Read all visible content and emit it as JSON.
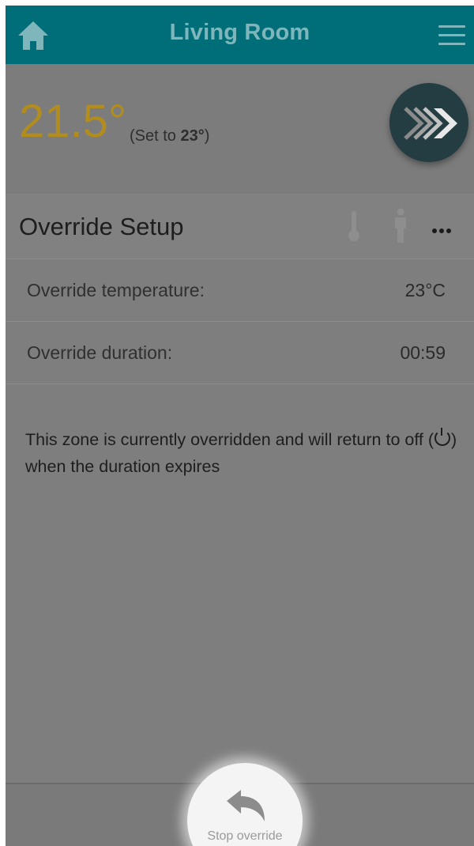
{
  "header": {
    "title": "Living Room",
    "home_icon": "home-icon",
    "menu_icon": "hamburger-menu-icon"
  },
  "temperature": {
    "current": "21.5°",
    "set_prefix": "(Set to ",
    "set_value": "23°",
    "set_suffix": ")",
    "boost_icon": "fast-forward-chevrons-icon"
  },
  "override_setup": {
    "title": "Override Setup",
    "icons": [
      "thermometer-icon",
      "person-icon",
      "more-icon"
    ],
    "rows": [
      {
        "label": "Override temperature:",
        "value": "23°C"
      },
      {
        "label": "Override duration:",
        "value": "00:59"
      }
    ],
    "info_before": "This zone is currently overridden and will return to off (",
    "info_after": ") when the duration expires"
  },
  "bottom_bar": {
    "stop_label": "Stop override",
    "stop_icon": "undo-arrow-icon"
  },
  "colors": {
    "header": "#006e78",
    "temp": "#b28d1d",
    "boost_button": "#243d42"
  }
}
